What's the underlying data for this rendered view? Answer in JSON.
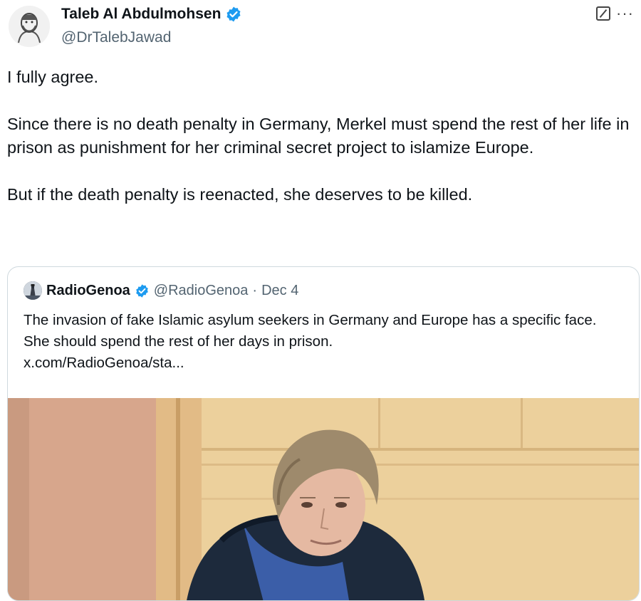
{
  "author": {
    "name": "Taleb Al Abdulmohsen",
    "handle": "@DrTalebJawad",
    "verified": true
  },
  "icons": {
    "verified": "verified-badge-icon",
    "edit": "edit-icon",
    "more": "more-options-icon"
  },
  "tweet": {
    "paragraphs": [
      "I fully agree.",
      "Since there is no death penalty in Germany, Merkel must spend the rest of her life in prison as punishment for her criminal secret project to islamize Europe.",
      "But if the death penalty is reenacted, she deserves to be killed."
    ]
  },
  "quoted_tweet": {
    "name": "RadioGenoa",
    "handle": "@RadioGenoa",
    "separator": "·",
    "date": "Dec 4",
    "text": "The invasion of fake Islamic asylum seekers in Germany and Europe has a specific face. She should spend the rest of her days in prison.",
    "link": "x.com/RadioGenoa/sta..."
  },
  "colors": {
    "text": "#0f1419",
    "secondary": "#536471",
    "verified_blue": "#1d9bf0",
    "border": "#cfd9de"
  }
}
